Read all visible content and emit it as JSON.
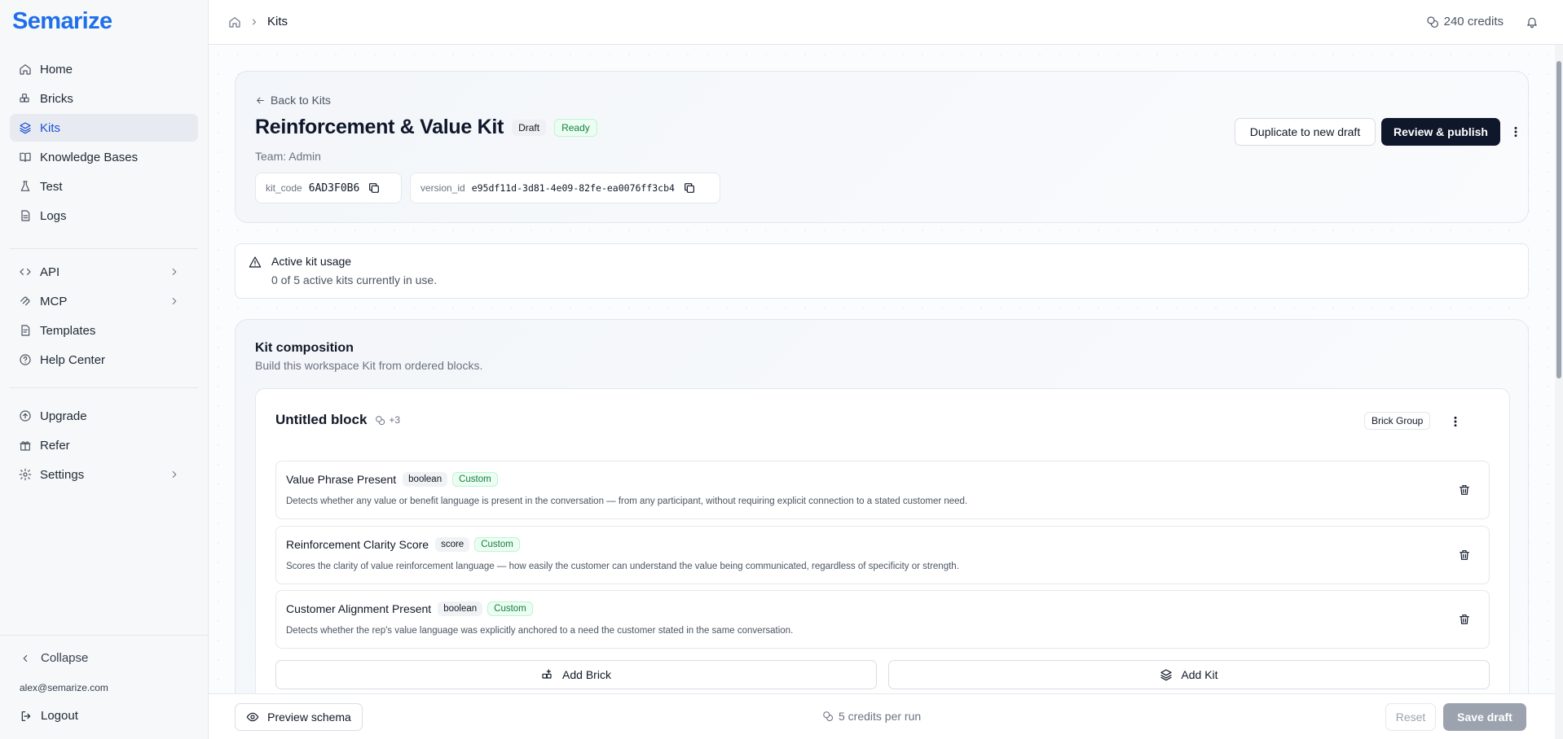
{
  "app": {
    "logo": "Semarize"
  },
  "sidebar": {
    "primary": [
      {
        "label": "Home",
        "icon": "home-icon"
      },
      {
        "label": "Bricks",
        "icon": "bricks-icon"
      },
      {
        "label": "Kits",
        "icon": "layers-icon",
        "active": true
      },
      {
        "label": "Knowledge Bases",
        "icon": "book-icon"
      },
      {
        "label": "Test",
        "icon": "flask-icon"
      },
      {
        "label": "Logs",
        "icon": "document-icon"
      }
    ],
    "secondary": [
      {
        "label": "API",
        "icon": "code-icon"
      },
      {
        "label": "MCP",
        "icon": "mcp-icon"
      },
      {
        "label": "Templates",
        "icon": "template-icon"
      },
      {
        "label": "Help Center",
        "icon": "help-icon"
      }
    ],
    "tertiary": [
      {
        "label": "Upgrade",
        "icon": "upgrade-icon"
      },
      {
        "label": "Refer",
        "icon": "gift-icon"
      },
      {
        "label": "Settings",
        "icon": "gear-icon"
      }
    ],
    "collapse_label": "Collapse",
    "user_email": "alex@semarize.com",
    "logout_label": "Logout"
  },
  "topbar": {
    "breadcrumb_current": "Kits",
    "credits": "240 credits"
  },
  "kit": {
    "back_label": "Back to Kits",
    "title": "Reinforcement & Value Kit",
    "status_draft": "Draft",
    "status_ready": "Ready",
    "team": "Team: Admin",
    "kit_code_key": "kit_code",
    "kit_code": "6AD3F0B6",
    "version_id_key": "version_id",
    "version_id": "e95df11d-3d81-4e09-82fe-ea0076ff3cb4",
    "duplicate_label": "Duplicate to new draft",
    "publish_label": "Review & publish"
  },
  "usage": {
    "title": "Active kit usage",
    "subtitle": "0 of 5 active kits currently in use."
  },
  "composition": {
    "title": "Kit composition",
    "subtitle": "Build this workspace Kit from ordered blocks.",
    "block": {
      "name": "Untitled block",
      "meta": "+3",
      "type_badge": "Brick Group",
      "bricks": [
        {
          "name": "Value Phrase Present",
          "type": "boolean",
          "source": "Custom",
          "description": "Detects whether any value or benefit language is present in the conversation — from any participant, without requiring explicit connection to a stated customer need."
        },
        {
          "name": "Reinforcement Clarity Score",
          "type": "score",
          "source": "Custom",
          "description": "Scores the clarity of value reinforcement language — how easily the customer can understand the value being communicated, regardless of specificity or strength."
        },
        {
          "name": "Customer Alignment Present",
          "type": "boolean",
          "source": "Custom",
          "description": "Detects whether the rep's value language was explicitly anchored to a need the customer stated in the same conversation."
        }
      ],
      "add_brick_label": "Add Brick",
      "add_kit_label": "Add Kit"
    }
  },
  "footer": {
    "preview_label": "Preview schema",
    "credits_per_run": "5 credits per run",
    "reset_label": "Reset",
    "save_label": "Save draft"
  }
}
